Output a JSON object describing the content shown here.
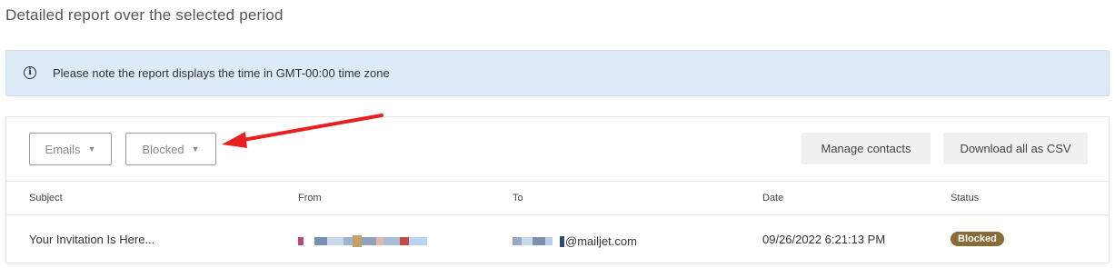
{
  "page": {
    "title": "Detailed report over the selected period"
  },
  "notice": {
    "icon": "info-icon",
    "text": "Please note the report displays the time in GMT-00:00 time zone"
  },
  "filters": {
    "type_label": "Emails",
    "status_label": "Blocked"
  },
  "actions": {
    "manage_label": "Manage contacts",
    "download_label": "Download all as CSV"
  },
  "table": {
    "columns": [
      "Subject",
      "From",
      "To",
      "Date",
      "Status"
    ],
    "rows": [
      {
        "subject": "Your Invitation Is Here...",
        "to_domain": "@mailjet.com",
        "date": "09/26/2022 6:21:13 PM",
        "status": "Blocked"
      }
    ]
  },
  "colors": {
    "notice_bg": "#dcebf7",
    "status_blocked": "#8a6a35",
    "annotation_arrow": "#e8201f"
  }
}
